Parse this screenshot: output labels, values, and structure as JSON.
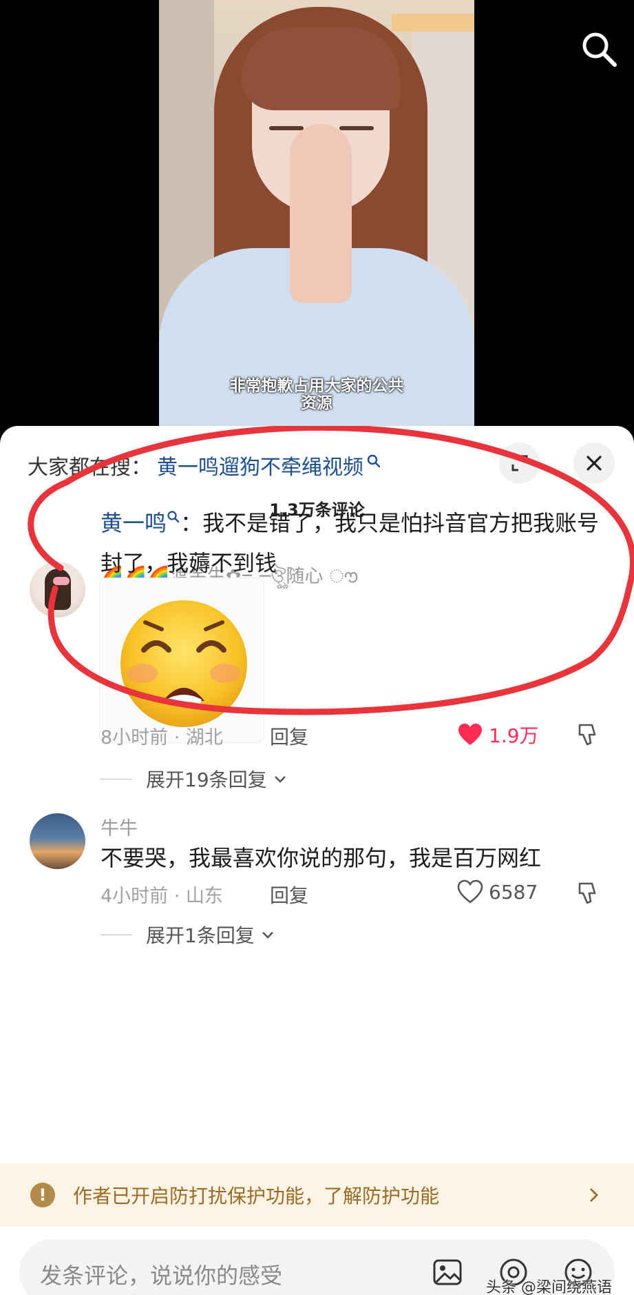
{
  "video": {
    "caption_line1": "非常抱歉占用大家的公共",
    "caption_line2": "资源"
  },
  "trending": {
    "prefix": "大家都在搜：",
    "keyword": "黄一鸣遛狗不牵绳视频"
  },
  "comment_count": "1.3万条评论",
  "comments": [
    {
      "username": "🌈🌈🌈渡余生✿ᯓ─ঔৣ随心 ൗ",
      "mention": "黄一鸣",
      "text_after_mention": "：我不是错了，我只是怕抖音官方把我账号封了，我薅不到钱",
      "time_location": "8小时前 · 湖北",
      "reply_label": "回复",
      "likes": "1.9万",
      "liked": true,
      "expand_label": "展开19条回复"
    },
    {
      "username": "牛牛",
      "text": "不要哭，我最喜欢你说的那句，我是百万网红",
      "time_location": "4小时前 · 山东",
      "reply_label": "回复",
      "likes": "6587",
      "liked": false,
      "expand_label": "展开1条回复"
    }
  ],
  "notice": {
    "text": "作者已开启防打扰保护功能，了解防护功能"
  },
  "input": {
    "placeholder": "发条评论，说说你的感受"
  },
  "watermark": "头条 @梁间绕燕语",
  "colors": {
    "accent_red": "#fe2c55",
    "mention_blue": "#1d4f91",
    "annotation_red": "#e8343a",
    "notice_bg": "#fdf4e5",
    "notice_text": "#9b6b26"
  },
  "icons": [
    "search-icon",
    "expand-icon",
    "close-icon",
    "heart-icon",
    "dislike-icon",
    "chevron-down-icon",
    "warning-icon",
    "chevron-right-icon",
    "image-icon",
    "at-icon",
    "emoji-icon"
  ]
}
